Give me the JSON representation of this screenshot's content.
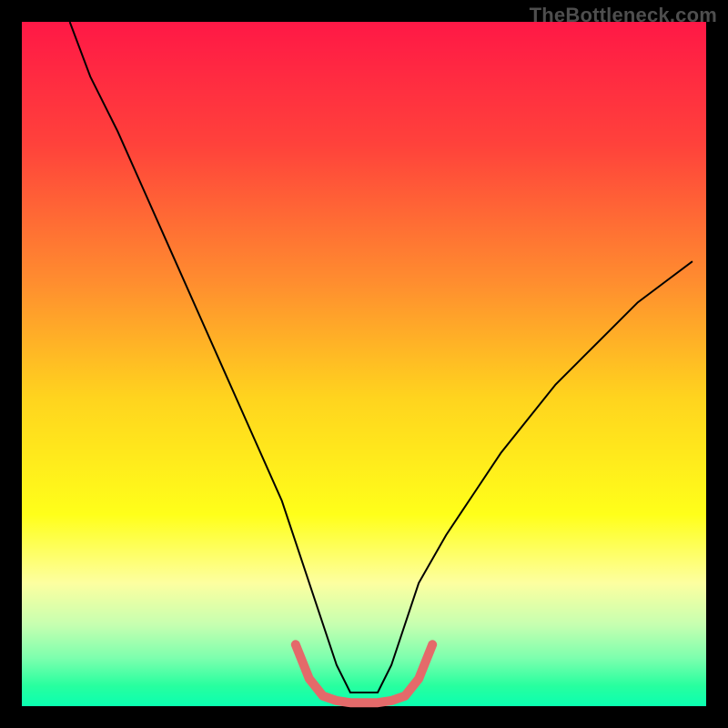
{
  "watermark": "TheBottleneck.com",
  "chart_data": {
    "type": "line",
    "title": "",
    "xlabel": "",
    "ylabel": "",
    "xlim": [
      0,
      100
    ],
    "ylim": [
      0,
      100
    ],
    "legend": false,
    "grid": false,
    "background_gradient": {
      "type": "vertical",
      "stops": [
        {
          "offset": 0.0,
          "color": "#ff1846"
        },
        {
          "offset": 0.18,
          "color": "#ff423b"
        },
        {
          "offset": 0.38,
          "color": "#ff8d2f"
        },
        {
          "offset": 0.55,
          "color": "#ffd41e"
        },
        {
          "offset": 0.72,
          "color": "#ffff1a"
        },
        {
          "offset": 0.82,
          "color": "#fdffa0"
        },
        {
          "offset": 0.88,
          "color": "#c7ffb0"
        },
        {
          "offset": 0.93,
          "color": "#7cffae"
        },
        {
          "offset": 0.97,
          "color": "#28ff9f"
        },
        {
          "offset": 1.0,
          "color": "#0affb0"
        }
      ]
    },
    "series": [
      {
        "name": "bottleneck-curve",
        "color": "#000000",
        "stroke_width": 2,
        "x": [
          7,
          10,
          14,
          18,
          22,
          26,
          30,
          34,
          38,
          42,
          44,
          46,
          48,
          52,
          54,
          56,
          58,
          62,
          66,
          70,
          74,
          78,
          82,
          86,
          90,
          94,
          98
        ],
        "y": [
          100,
          92,
          84,
          75,
          66,
          57,
          48,
          39,
          30,
          18,
          12,
          6,
          2,
          2,
          6,
          12,
          18,
          25,
          31,
          37,
          42,
          47,
          51,
          55,
          59,
          62,
          65
        ]
      },
      {
        "name": "optimal-zone-marker",
        "color": "#e46a6a",
        "stroke_width": 10,
        "stroke_linecap": "round",
        "x": [
          40,
          42,
          44,
          46,
          48,
          50,
          52,
          54,
          56,
          58,
          60
        ],
        "y": [
          9,
          4,
          1.5,
          0.8,
          0.5,
          0.5,
          0.5,
          0.8,
          1.5,
          4,
          9
        ]
      }
    ]
  }
}
